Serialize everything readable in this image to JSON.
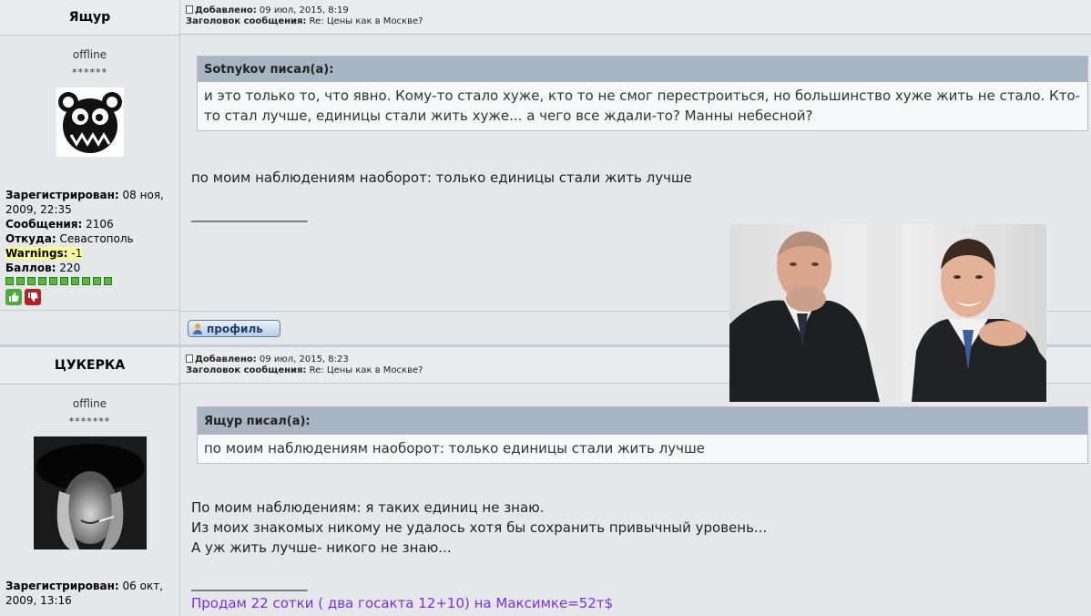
{
  "posts": [
    {
      "author": "Ящур",
      "added_label": "Добавлено:",
      "added_date": "09 июл, 2015, 8:19",
      "subject_label": "Заголовок сообщения:",
      "subject": "Re: Цены как в Москве?",
      "status": "offline",
      "stars": "******",
      "registered_label": "Зарегистрирован:",
      "registered": "08 ноя, 2009, 22:35",
      "messages_label": "Сообщения:",
      "messages": "2106",
      "from_label": "Откуда:",
      "from": "Севастополь",
      "warnings_label": "Warnings:",
      "warnings": "-1",
      "points_label": "Баллов:",
      "points": "220",
      "quote_author": "Sotnykov писал(а):",
      "quote_text": "и это только то, что явно. Кому-то стало хуже, кто то не смог перестроиться, но большинство хуже жить не стало. Кто-то стал лучше, единицы стали жить хуже... а чего все ждали-то? Манны небесной?",
      "text": "по моим наблюдениям наоборот: только единицы стали жить лучше",
      "signature_line": "_________________",
      "profile_button": "профиль"
    },
    {
      "author": "ЦУКЕРКА",
      "added_label": "Добавлено:",
      "added_date": "09 июл, 2015, 8:23",
      "subject_label": "Заголовок сообщения:",
      "subject": "Re: Цены как в Москве?",
      "status": "offline",
      "stars": "*******",
      "registered_label": "Зарегистрирован:",
      "registered": "06 окт, 2009, 13:16",
      "quote_author": "Ящур писал(а):",
      "quote_text": "по моим наблюдениям наоборот: только единицы стали жить лучше",
      "text_lines": [
        "По моим наблюдениям: я таких единиц не знаю.",
        "Из моих знакомых никому не удалось хотя бы сохранить привычный уровень...",
        "А уж жить лучше- никого не знаю..."
      ],
      "signature_line": "_________________",
      "signature_ad": "Продам 22 сотки ( два госакта 12+10) на Максимке=52т$"
    }
  ],
  "colors": {
    "background": "#e5e8eb",
    "quote_header": "#a9b5c2",
    "signature_ad": "#7a2fe0",
    "warning_highlight": "#ffff99"
  }
}
